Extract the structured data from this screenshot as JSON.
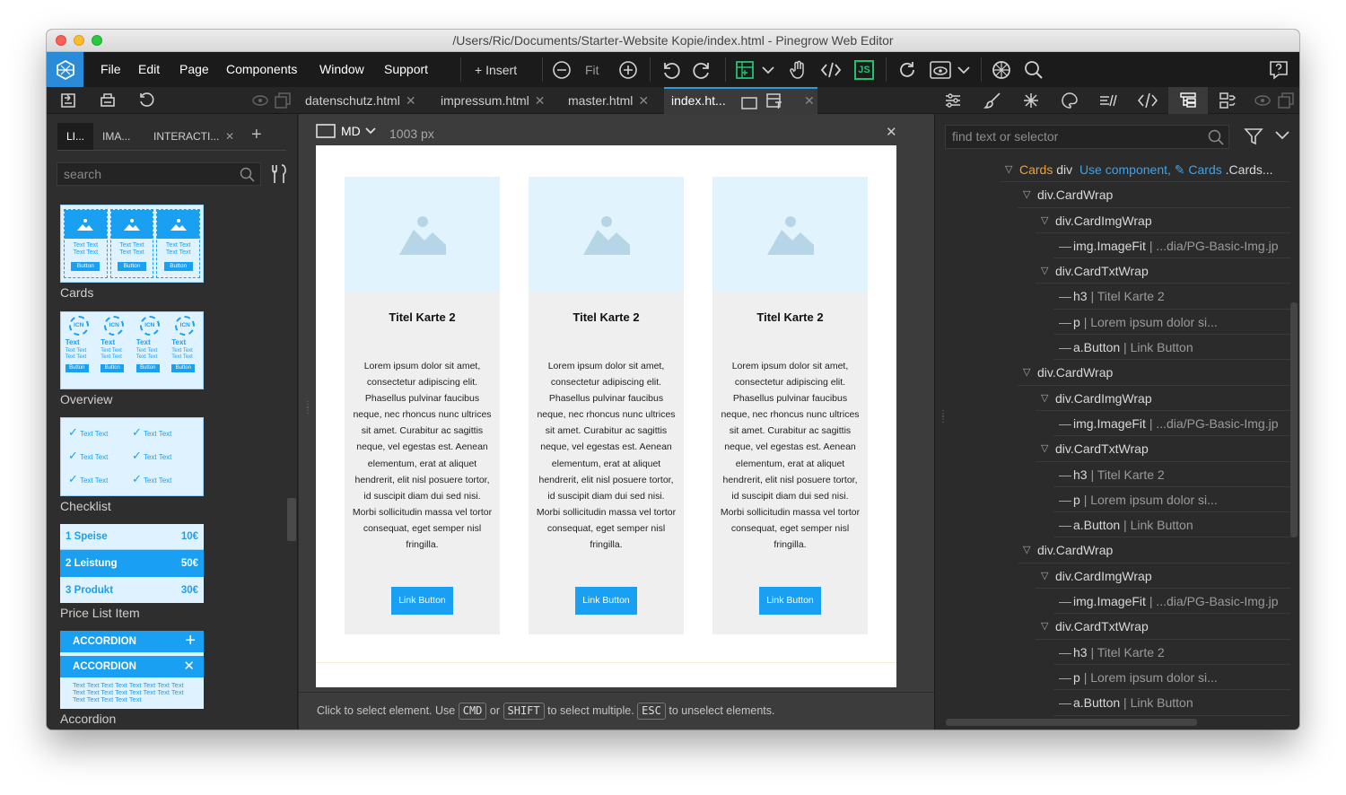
{
  "window": {
    "title": "/Users/Ric/Documents/Starter-Website Kopie/index.html - Pinegrow Web Editor"
  },
  "menu": [
    "File",
    "Edit",
    "Page",
    "Components",
    "Window",
    "Support"
  ],
  "toolbar": {
    "insert": "+ Insert",
    "fit": "Fit",
    "js": "JS"
  },
  "file_tabs": [
    "datenschutz.html",
    "impressum.html",
    "master.html",
    "index.ht..."
  ],
  "library": {
    "tabs": [
      "LI...",
      "IMA...",
      "INTERACTI..."
    ],
    "search_placeholder": "search",
    "items": [
      "Cards",
      "Overview",
      "Checklist",
      "Price List Item",
      "Accordion"
    ],
    "card_thumb": {
      "text1": "Text Text",
      "text2": "Text Text",
      "button": "Button"
    },
    "overview_thumb": {
      "icon": "ICN",
      "title": "Text",
      "text1": "Text Text",
      "text2": "Text Text",
      "button": "Button"
    },
    "checklist_thumb": {
      "item": "Text Text"
    },
    "price_rows": [
      {
        "label": "1 Speise",
        "price": "10€"
      },
      {
        "label": "2 Leistung",
        "price": "50€"
      },
      {
        "label": "3 Produkt",
        "price": "30€"
      }
    ],
    "accordion_thumb": {
      "header": "ACCORDION",
      "text": "Text Text Text Text Text Text Text Text Text Text Text Text Text Text Text Text Text Text Text Text Text"
    }
  },
  "canvas_bar": {
    "breakpoint": "MD",
    "width": "1003 px"
  },
  "cards": [
    {
      "title": "Titel Karte 2",
      "text": "Lorem ipsum dolor sit amet, consectetur adipiscing elit. Phasellus pulvinar faucibus neque, nec rhoncus nunc ultrices sit amet. Curabitur ac sagittis neque, vel egestas est. Aenean elementum, erat at aliquet hendrerit, elit nisl posuere tortor, id suscipit diam dui sed nisi. Morbi sollicitudin massa vel tortor consequat, eget semper nisl fringilla.",
      "button": "Link Button"
    },
    {
      "title": "Titel Karte 2",
      "text": "Lorem ipsum dolor sit amet, consectetur adipiscing elit. Phasellus pulvinar faucibus neque, nec rhoncus nunc ultrices sit amet. Curabitur ac sagittis neque, vel egestas est. Aenean elementum, erat at aliquet hendrerit, elit nisl posuere tortor, id suscipit diam dui sed nisi. Morbi sollicitudin massa vel tortor consequat, eget semper nisl fringilla.",
      "button": "Link Button"
    },
    {
      "title": "Titel Karte 2",
      "text": "Lorem ipsum dolor sit amet, consectetur adipiscing elit. Phasellus pulvinar faucibus neque, nec rhoncus nunc ultrices sit amet. Curabitur ac sagittis neque, vel egestas est. Aenean elementum, erat at aliquet hendrerit, elit nisl posuere tortor, id suscipit diam dui sed nisi. Morbi sollicitudin massa vel tortor consequat, eget semper nisl fringilla.",
      "button": "Link Button"
    }
  ],
  "status": {
    "pre": "Click to select element. Use",
    "k1": "CMD",
    "or": "or",
    "k2": "SHIFT",
    "mid": "to select multiple.",
    "k3": "ESC",
    "post": "to unselect elements."
  },
  "tree": {
    "search_placeholder": "find text or selector",
    "root": {
      "label": "Cards",
      "tag": "div",
      "use": "Use component,",
      "comp": "Cards",
      "cls": ".Cards..."
    },
    "cardwrap": "div.CardWrap",
    "imgwrap": "div.CardImgWrap",
    "img": "img.ImageFit",
    "img_src": "| ...dia/PG-Basic-Img.jp",
    "txtwrap": "div.CardTxtWrap",
    "h3": "h3",
    "h3_text": "| Titel Karte 2",
    "p": "p",
    "p_text": "| Lorem ipsum dolor si...",
    "a": "a.Button",
    "a_text": "| Link Button"
  },
  "colors": {
    "accent": "#1aa0f2",
    "logo": "#2a8cd8",
    "js": "#25c16f",
    "root_label": "#f0a030",
    "link": "#3aa3f0"
  }
}
